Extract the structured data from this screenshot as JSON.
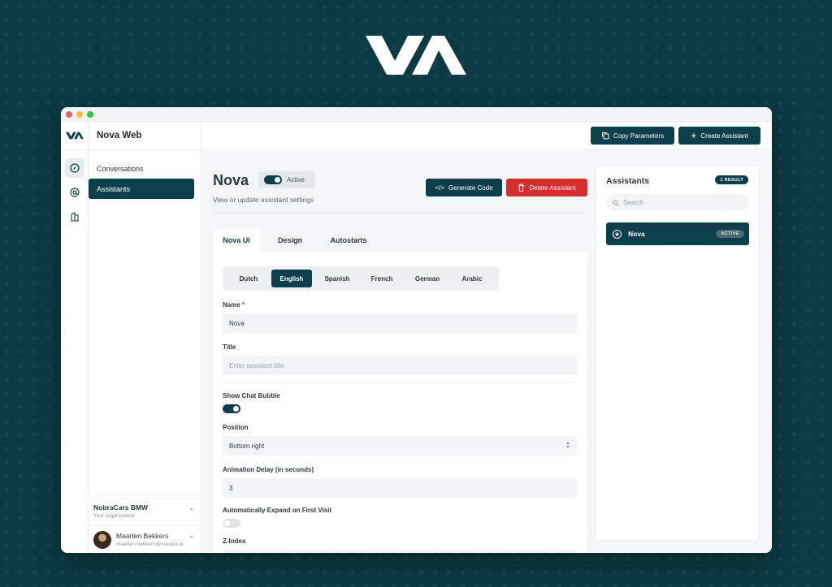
{
  "brand": {
    "logo_icon": "va-logo-icon"
  },
  "app": {
    "title": "Nova Web"
  },
  "rail": {
    "icons": [
      "compass-icon",
      "at-sign-icon",
      "building-icon"
    ]
  },
  "sidebar": {
    "items": [
      {
        "label": "Conversations",
        "active": false
      },
      {
        "label": "Assistants",
        "active": true
      }
    ],
    "organisation": {
      "name": "NobraCars BMW",
      "subtitle": "Your organisation"
    },
    "user": {
      "name": "Maarten Bekkers",
      "email": "maarten.bekkers@novaco.ai"
    }
  },
  "toolbar": {
    "copy_label": "Copy Parameters",
    "create_label": "Create Assistant"
  },
  "assistant": {
    "name": "Nova",
    "status": "Active",
    "subtitle": "View or update assistant settings",
    "generate_label": "Generate Code",
    "delete_label": "Delete Assistant"
  },
  "tabs": [
    {
      "label": "Nova UI",
      "active": true
    },
    {
      "label": "Design",
      "active": false
    },
    {
      "label": "Autostarts",
      "active": false
    }
  ],
  "languages": [
    {
      "label": "Dutch",
      "active": false
    },
    {
      "label": "English",
      "active": true
    },
    {
      "label": "Spanish",
      "active": false
    },
    {
      "label": "French",
      "active": false
    },
    {
      "label": "German",
      "active": false
    },
    {
      "label": "Arabic",
      "active": false
    }
  ],
  "form": {
    "name_label": "Name",
    "name_required_mark": "*",
    "name_value": "Nova",
    "title_label": "Title",
    "title_placeholder": "Enter assistant title",
    "bubble_label": "Show Chat Bubble",
    "bubble_on": true,
    "position_label": "Position",
    "position_value": "Bottom right",
    "delay_label": "Animation Delay (in seconds)",
    "delay_value": "3",
    "expand_label": "Automatically Expand on First Visit",
    "expand_on": false,
    "zindex_label": "Z-Index"
  },
  "results_panel": {
    "title": "Assistants",
    "count_badge": "1 RESULT",
    "search_placeholder": "Search",
    "items": [
      {
        "name": "Nova",
        "status": "ACTIVE"
      }
    ]
  },
  "colors": {
    "accent": "#0b3f4b",
    "danger": "#d62e2e",
    "background": "#0b3a44"
  }
}
